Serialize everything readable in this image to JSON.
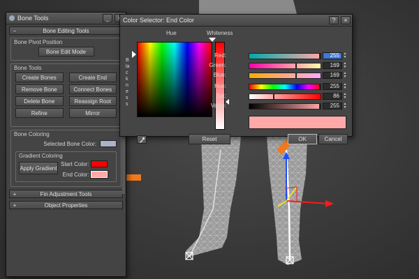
{
  "bone_tools": {
    "title": "Bone Tools",
    "rollout_editing": "Bone Editing Tools",
    "pivot_group": "Bone Pivot Position",
    "bone_edit_mode": "Bone Edit Mode",
    "bone_tools_group": "Bone Tools",
    "buttons": [
      "Create Bones",
      "Create End",
      "Remove Bone",
      "Connect Bones",
      "Delete Bone",
      "Reassign Root",
      "Refine",
      "Mirror"
    ],
    "coloring_group": "Bone Coloring",
    "selected_bone_color_label": "Selected Bone Color:",
    "gradient_group": "Gradient Coloring",
    "apply_gradient": "Apply Gradient",
    "start_color_label": "Start Color:",
    "end_color_label": "End Color:",
    "rollout_fin": "Fin Adjustment Tools",
    "rollout_object": "Object Properties",
    "collapsed_sign": "+",
    "expanded_sign": "−",
    "colors": {
      "selected_bone": "#a9b4c8",
      "start": "#ff0000",
      "end": "#ffa9a9"
    }
  },
  "color_selector": {
    "title": "Color Selector: End Color",
    "hue_label": "Hue",
    "whiteness_label": "Whiteness",
    "blackness_label": "Blackness",
    "channels": [
      {
        "label": "Red:",
        "value": "255",
        "fraction": 1.0
      },
      {
        "label": "Green:",
        "value": "169",
        "fraction": 0.663
      },
      {
        "label": "Blue:",
        "value": "169",
        "fraction": 0.663
      },
      {
        "label": "Hue:",
        "value": "255",
        "fraction": 1.0
      },
      {
        "label": "Sat:",
        "value": "86",
        "fraction": 0.337
      },
      {
        "label": "Value:",
        "value": "255",
        "fraction": 1.0
      }
    ],
    "reset": "Reset",
    "ok": "OK",
    "cancel": "Cancel",
    "preview_color": "#ffa9a9"
  },
  "window_buttons": {
    "help": "?",
    "minimize": "_",
    "close": "×"
  },
  "annotation_color": "#f07a1e"
}
